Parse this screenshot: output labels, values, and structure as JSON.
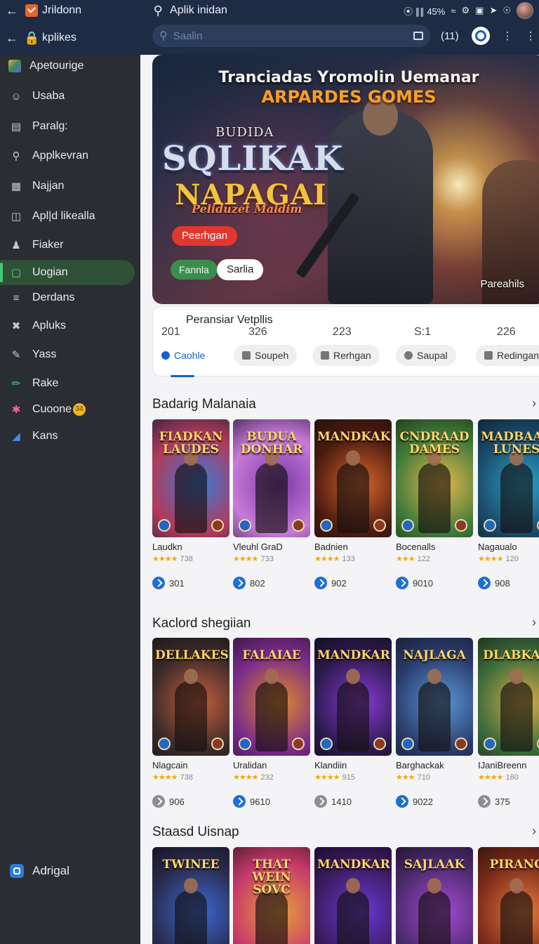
{
  "topbar": {
    "app_name": "Jrildonn",
    "title": "Aplik inidan",
    "status_text": "⦿ ∥∥ 45%",
    "tab_label": "kplikes",
    "search_placeholder": "Saalin",
    "counter": "(11)",
    "status_colors": {
      "bar": "#1e2b45",
      "search": "#2c3d5c"
    }
  },
  "sidebar": {
    "items": [
      {
        "label": "Apetourige",
        "icon": "grid-icon"
      },
      {
        "label": "Usaba",
        "icon": "user-icon"
      },
      {
        "label": "Paralg:",
        "icon": "screen-icon"
      },
      {
        "label": "Applkevran",
        "icon": "search-icon"
      },
      {
        "label": "Najjan",
        "icon": "table-icon"
      },
      {
        "label": "Apl|d likealla",
        "icon": "layout-icon"
      },
      {
        "label": "Fiaker",
        "icon": "person-icon"
      },
      {
        "label": "Uogian",
        "icon": "square-icon"
      },
      {
        "label": "Derdans",
        "icon": "menu-icon"
      },
      {
        "label": "Apluks",
        "icon": "cross-icon"
      },
      {
        "label": "Yass",
        "icon": "pencil-icon"
      },
      {
        "label": "Rake",
        "icon": "edit-icon"
      },
      {
        "label": "Cuoone",
        "icon": "puzzle-icon",
        "badge": "34"
      },
      {
        "label": "Kans",
        "icon": "chart-icon"
      }
    ],
    "bottom_label": "Adrigal"
  },
  "hero": {
    "headline": "Tranciadas Yromolin Uemanar",
    "subheadline": "ARPARDES GOMES",
    "kicker": "BUDIDA",
    "logo_line1": "SQLIKAK",
    "logo_line2": "NAPAGAI",
    "tagline": "Peliduzet Maldim",
    "primary_button": "Peerhgan",
    "tag_green": "Fannla",
    "tag_white": "Sarlia",
    "corner_text": "Pareahils"
  },
  "stats_card": {
    "title": "Peransiar Vetpllis",
    "numbers": [
      "201",
      "326",
      "223",
      "S:1",
      "226"
    ],
    "tabs": [
      {
        "label": "Caohle",
        "active": true
      },
      {
        "label": "Soupeh",
        "active": false
      },
      {
        "label": "Rerhgan",
        "active": false
      },
      {
        "label": "Saupal",
        "active": false
      },
      {
        "label": "Redingan",
        "active": false
      }
    ]
  },
  "sections": [
    {
      "title": "Badarig Malanaia",
      "cards": [
        {
          "art_title": "FIADKAN LAUDES",
          "name": "Laudkn",
          "rating": "738",
          "count": "301",
          "stars": "★★★★",
          "colors": [
            "#3a7ad8",
            "#b23a5a",
            "#1b1f3a"
          ]
        },
        {
          "art_title": "BUDUA DONHAR",
          "name": "Vleuhl GraD",
          "rating": "733",
          "count": "802",
          "stars": "★★★★",
          "colors": [
            "#7a3aa8",
            "#c87ad8",
            "#2a163c"
          ]
        },
        {
          "art_title": "MANDKAK",
          "name": "Badnien",
          "rating": "133",
          "count": "902",
          "stars": "★★★★",
          "colors": [
            "#d8652a",
            "#4a1a10",
            "#1a0e0a"
          ]
        },
        {
          "art_title": "CNDRAAD DAMES",
          "name": "Bocenalls",
          "rating": "122",
          "count": "9010",
          "stars": "★★★",
          "colors": [
            "#e9b94a",
            "#3e7a3a",
            "#1c2a14"
          ]
        },
        {
          "art_title": "MADBAAR LUNES",
          "name": "Nagaualo",
          "rating": "120",
          "count": "908",
          "stars": "★★★★",
          "colors": [
            "#2aa3c8",
            "#1a4a6a",
            "#0e1a22"
          ]
        }
      ]
    },
    {
      "title": "Kaclord shegiian",
      "cards": [
        {
          "art_title": "DELLAKES",
          "name": "Nlagcain",
          "rating": "738",
          "count": "906",
          "stars": "★★★★",
          "countGrey": true,
          "colors": [
            "#c8603a",
            "#3a2a2a",
            "#141414"
          ]
        },
        {
          "art_title": "FALAIAE",
          "name": "Uralidan",
          "rating": "232",
          "count": "9610",
          "stars": "★★★★",
          "colors": [
            "#e08a2a",
            "#7a2a8a",
            "#2a1430"
          ]
        },
        {
          "art_title": "MANDKAR",
          "name": "Klandiin",
          "rating": "915",
          "count": "1410",
          "stars": "★★★★",
          "countGrey": true,
          "colors": [
            "#8a3ad8",
            "#2a1a4a",
            "#0e0a1a"
          ]
        },
        {
          "art_title": "NAJLAGA",
          "name": "Barghackak",
          "rating": "710",
          "count": "9022",
          "stars": "★★★",
          "colors": [
            "#5a9ad8",
            "#2a3a6a",
            "#141a2a"
          ]
        },
        {
          "art_title": "DLABKAR",
          "name": "IJaniBreenn",
          "rating": "160",
          "count": "375",
          "stars": "★★★★",
          "countGrey": true,
          "colors": [
            "#d8b04a",
            "#3a6a3a",
            "#1a2214"
          ]
        }
      ]
    },
    {
      "title": "Staasd Uisnap",
      "cards": [
        {
          "art_title": "TWINEE",
          "colors": [
            "#3a6ad8",
            "#2a2a4a",
            "#0e0e1a"
          ]
        },
        {
          "art_title": "THAT WEIN SOVC",
          "colors": [
            "#e8a03a",
            "#c83a6a",
            "#3a1420"
          ]
        },
        {
          "art_title": "MANDKAR",
          "colors": [
            "#6a3ad8",
            "#3a1a5a",
            "#120a20"
          ]
        },
        {
          "art_title": "SAJLAAK",
          "colors": [
            "#a84ad8",
            "#4a2a6a",
            "#1a0e24"
          ]
        },
        {
          "art_title": "PIRANC",
          "colors": [
            "#e87a3a",
            "#7a2a1a",
            "#22100a"
          ]
        }
      ]
    }
  ]
}
